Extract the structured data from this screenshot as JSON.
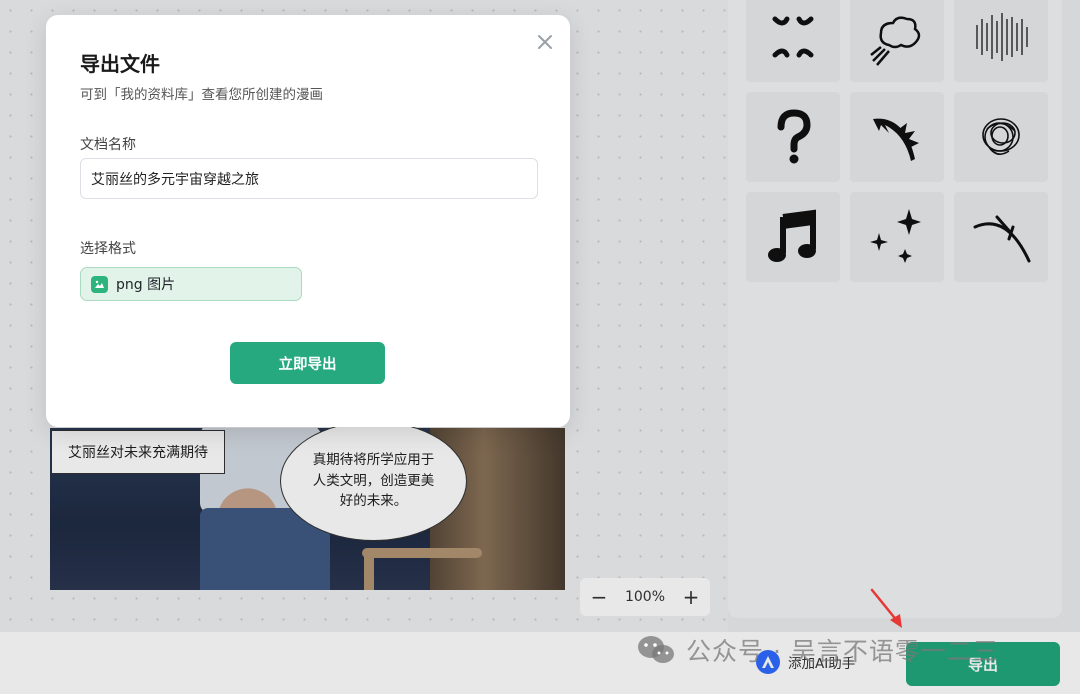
{
  "modal": {
    "title": "导出文件",
    "subtitle": "可到「我的资料库」查看您所创建的漫画",
    "name_label": "文档名称",
    "name_value": "艾丽丝的多元宇宙穿越之旅",
    "format_label": "选择格式",
    "format_option": "png 图片",
    "export_now_label": "立即导出"
  },
  "comic": {
    "caption": "艾丽丝对未来充满期待",
    "speech": "真期待将所学应用于人类文明，创造更美好的未来。"
  },
  "zoom": {
    "minus": "−",
    "level": "100%",
    "plus": "+"
  },
  "bottom": {
    "ai_helper_label": "添加AI助手",
    "export_label": "导出"
  },
  "watermark": {
    "text": "公众号 · 吴言不语零一二三"
  },
  "stickers": [
    "anger-mark-icon",
    "puff-cloud-icon",
    "vertical-lines-icon",
    "question-mark-icon",
    "spiky-burst-icon",
    "scribble-icon",
    "music-note-icon",
    "sparkles-icon",
    "crossed-lines-icon"
  ],
  "colors": {
    "accent": "#27a97f",
    "chip_bg": "#e2f3ea",
    "ai_blue": "#2f6bff"
  }
}
